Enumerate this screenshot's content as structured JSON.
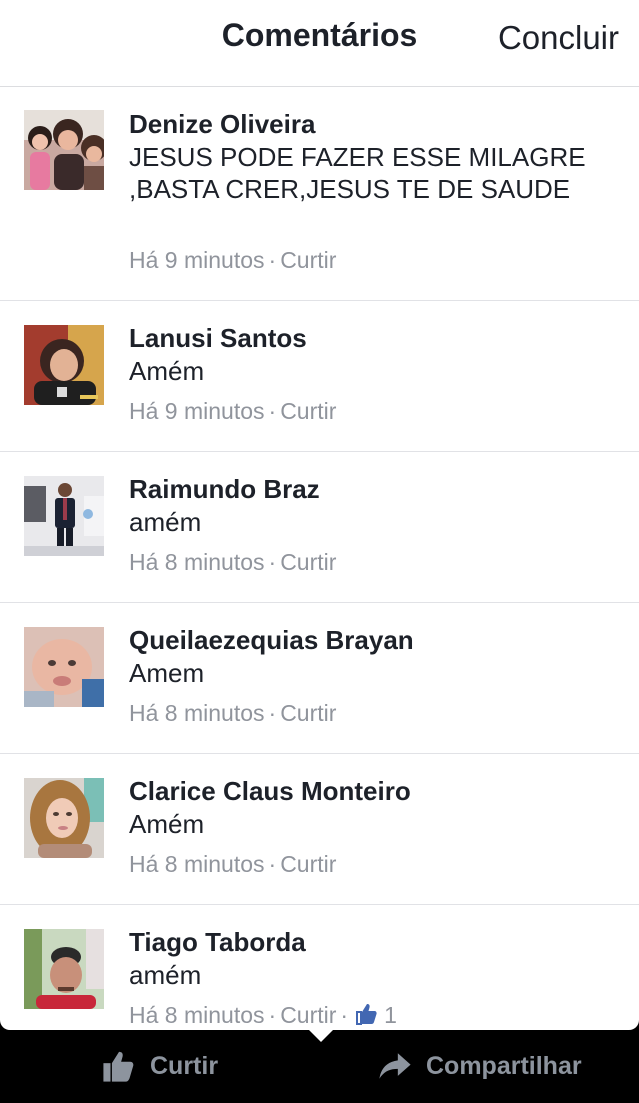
{
  "header": {
    "title": "Comentários",
    "done_label": "Concluir"
  },
  "comments": [
    {
      "author": "Denize Oliveira",
      "text": "JESUS PODE FAZER ESSE MILAGRE ,BASTA CRER,JESUS TE DE SAUDE",
      "time": "Há 9 minutos",
      "like_label": "Curtir"
    },
    {
      "author": "Lanusi Santos",
      "text": "Amém",
      "time": "Há 9 minutos",
      "like_label": "Curtir"
    },
    {
      "author": "Raimundo Braz",
      "text": "amém",
      "time": "Há 8 minutos",
      "like_label": "Curtir"
    },
    {
      "author": "Queilaezequias Brayan",
      "text": "Amem",
      "time": "Há 8 minutos",
      "like_label": "Curtir"
    },
    {
      "author": "Clarice Claus Monteiro",
      "text": "Amém",
      "time": "Há 8 minutos",
      "like_label": "Curtir"
    },
    {
      "author": "Tiago Taborda",
      "text": "amém",
      "time": "Há 8 minutos",
      "like_label": "Curtir",
      "like_count": "1"
    }
  ],
  "meta_separator": "·",
  "bottom_bar": {
    "like_label": "Curtir",
    "share_label": "Compartilhar"
  },
  "colors": {
    "text_primary": "#1d2129",
    "text_secondary": "#90949c",
    "like_blue": "#4267b2",
    "bar_background": "#000000",
    "bar_text": "#8d949e"
  },
  "icons": {
    "bar_like": "thumbs-up-icon",
    "bar_share": "share-arrow-icon",
    "comment_like": "thumbs-up-outline-icon"
  }
}
